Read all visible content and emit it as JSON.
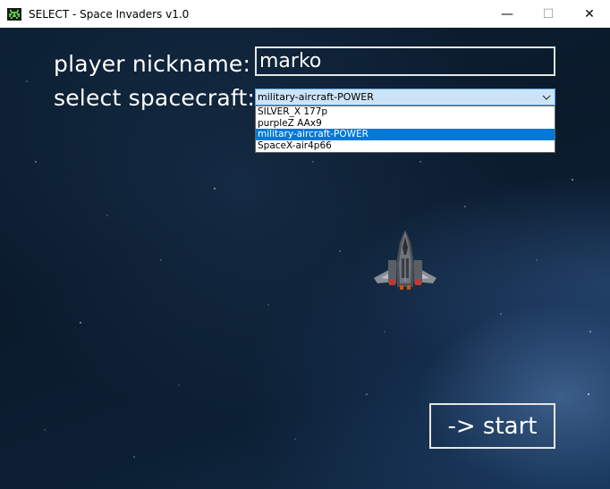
{
  "window": {
    "title": "SELECT - Space Invaders v1.0",
    "icon": "space-invader-icon",
    "controls": {
      "minimize": "—",
      "maximize": "☐",
      "close": "✕"
    }
  },
  "form": {
    "nickname_label": "player nickname:",
    "nickname_value": "marko",
    "spacecraft_label": "select spacecraft:",
    "spacecraft_selected": "military-aircraft-POWER",
    "spacecraft_options": [
      "SILVER_X 177p",
      "purpleZ AAx9",
      "military-aircraft-POWER",
      "SpaceX-air4p66"
    ],
    "start_label": "-> start"
  },
  "colors": {
    "select_bg": "#cce4f7",
    "select_border": "#5b9bd5",
    "option_highlight": "#0078d7",
    "text": "#ffffff"
  }
}
